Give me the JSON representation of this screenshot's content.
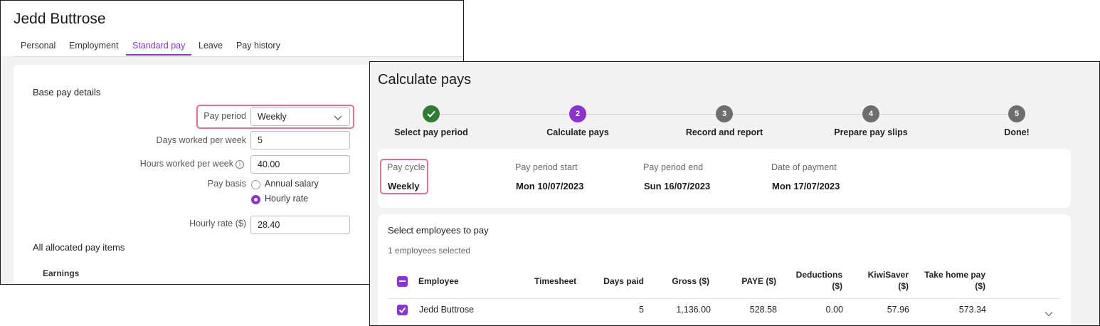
{
  "left": {
    "employee_name": "Jedd Buttrose",
    "tabs": [
      {
        "label": "Personal"
      },
      {
        "label": "Employment"
      },
      {
        "label": "Standard pay",
        "active": true
      },
      {
        "label": "Leave"
      },
      {
        "label": "Pay history"
      }
    ],
    "base_pay_title": "Base pay details",
    "pay_period_label": "Pay period",
    "pay_period_value": "Weekly",
    "days_label": "Days worked per week",
    "days_value": "5",
    "hours_label": "Hours worked per week",
    "hours_value": "40.00",
    "pay_basis_label": "Pay basis",
    "pay_basis_options": [
      "Annual salary",
      "Hourly rate"
    ],
    "pay_basis_selected": "Hourly rate",
    "hourly_rate_label": "Hourly rate ($)",
    "hourly_rate_value": "28.40",
    "allocated_title": "All allocated pay items",
    "earnings_title": "Earnings"
  },
  "right": {
    "title": "Calculate pays",
    "steps": [
      {
        "number": "",
        "label": "Select pay period",
        "state": "done"
      },
      {
        "number": "2",
        "label": "Calculate pays",
        "state": "current"
      },
      {
        "number": "3",
        "label": "Record and report",
        "state": "pending"
      },
      {
        "number": "4",
        "label": "Prepare pay slips",
        "state": "pending"
      },
      {
        "number": "5",
        "label": "Done!",
        "state": "pending"
      }
    ],
    "meta": {
      "pay_cycle_label": "Pay cycle",
      "pay_cycle_value": "Weekly",
      "start_label": "Pay period start",
      "start_value": "Mon 10/07/2023",
      "end_label": "Pay period end",
      "end_value": "Sun 16/07/2023",
      "payment_label": "Date of payment",
      "payment_value": "Mon 17/07/2023"
    },
    "employees": {
      "title": "Select employees to pay",
      "selected_count": "1 employees selected",
      "columns": {
        "employee": "Employee",
        "timesheet": "Timesheet",
        "days_paid": "Days paid",
        "gross": "Gross ($)",
        "paye": "PAYE ($)",
        "deductions_1": "Deductions",
        "deductions_2": "($)",
        "kiwisaver_1": "KiwiSaver",
        "kiwisaver_2": "($)",
        "takehome_1": "Take home pay",
        "takehome_2": "($)"
      },
      "rows": [
        {
          "name": "Jedd Buttrose",
          "days_paid": "5",
          "gross": "1,136.00",
          "paye": "528.58",
          "deductions": "0.00",
          "kiwisaver": "57.96",
          "takehome": "573.34"
        }
      ]
    }
  },
  "colors": {
    "accent": "#8a33d1",
    "done": "#2e7d32",
    "pending": "#6e6e6e",
    "highlight": "#e0709a"
  }
}
